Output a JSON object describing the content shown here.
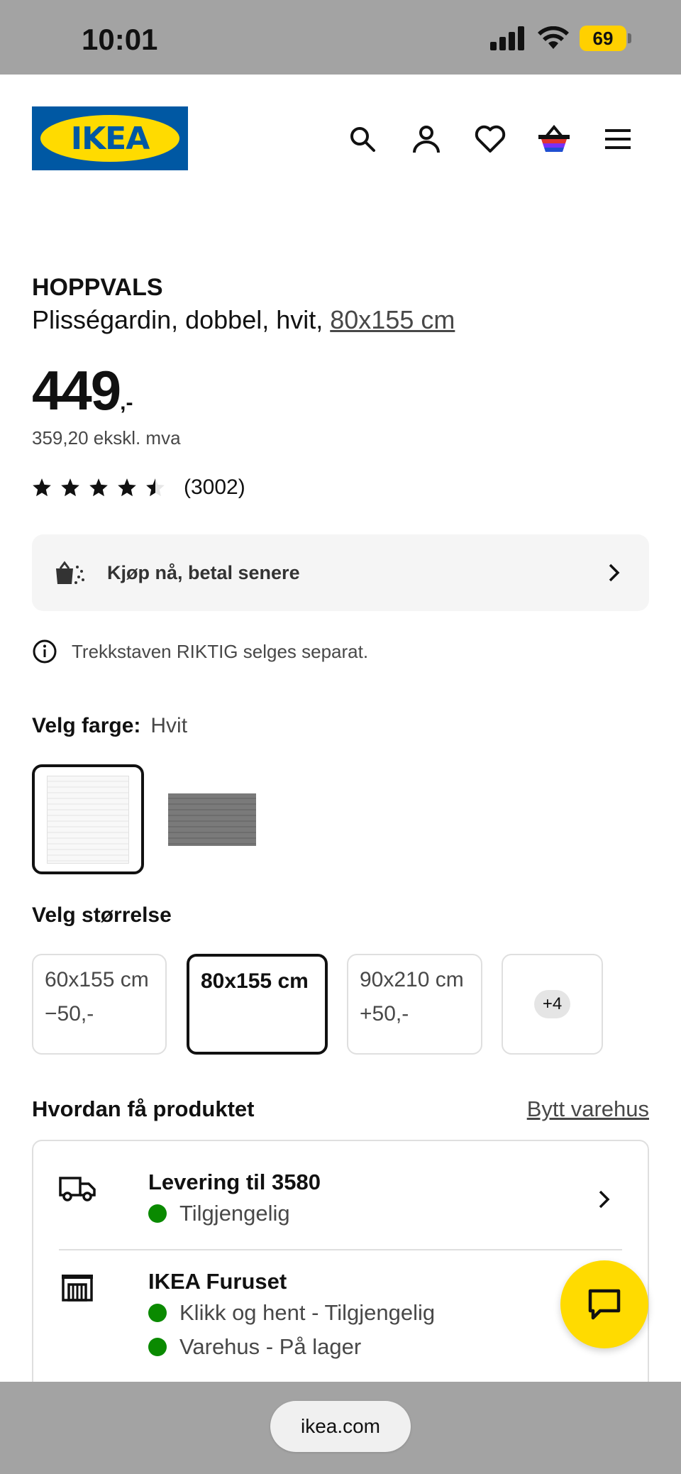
{
  "status_bar": {
    "time": "10:01",
    "battery": "69",
    "icons": [
      "signal-icon",
      "wifi-icon",
      "battery-icon"
    ]
  },
  "header": {
    "logo_text": "IKEA",
    "brand_colors": {
      "blue": "#0058a3",
      "yellow": "#ffdb00"
    },
    "icons": [
      "search-icon",
      "account-icon",
      "wishlist-heart-icon",
      "cart-basket-icon",
      "menu-icon"
    ]
  },
  "product": {
    "name": "HOPPVALS",
    "description": "Plisségardin, dobbel, hvit, ",
    "size_link": "80x155 cm",
    "price": "449",
    "price_suffix": ",-",
    "price_ex_vat": "359,20 ekskl. mva",
    "rating_stars": 4.5,
    "rating_max": 5,
    "rating_count": "(3002)"
  },
  "bnpl": {
    "label": "Kjøp nå, betal senere"
  },
  "info_note": {
    "text": "Trekkstaven RIKTIG selges separat."
  },
  "color_picker": {
    "label": "Velg farge:",
    "value": "Hvit",
    "options": [
      "white",
      "grey"
    ],
    "selected_index": 0
  },
  "size_picker": {
    "label": "Velg størrelse",
    "options": [
      {
        "name": "60x155 cm",
        "diff": "−50,-"
      },
      {
        "name": "80x155 cm",
        "diff": ""
      },
      {
        "name": "90x210 cm",
        "diff": "+50,-"
      }
    ],
    "more": "+4",
    "selected_index": 1
  },
  "availability": {
    "title": "Hvordan få produktet",
    "change_store": "Bytt varehus",
    "delivery": {
      "title": "Levering til 3580",
      "status": "Tilgjengelig"
    },
    "store": {
      "title": "IKEA Furuset",
      "click_collect": "Klikk og hent - Tilgjengelig",
      "in_store": "Varehus - På lager"
    },
    "status_color": "#0a8a00"
  },
  "browser": {
    "url": "ikea.com"
  }
}
